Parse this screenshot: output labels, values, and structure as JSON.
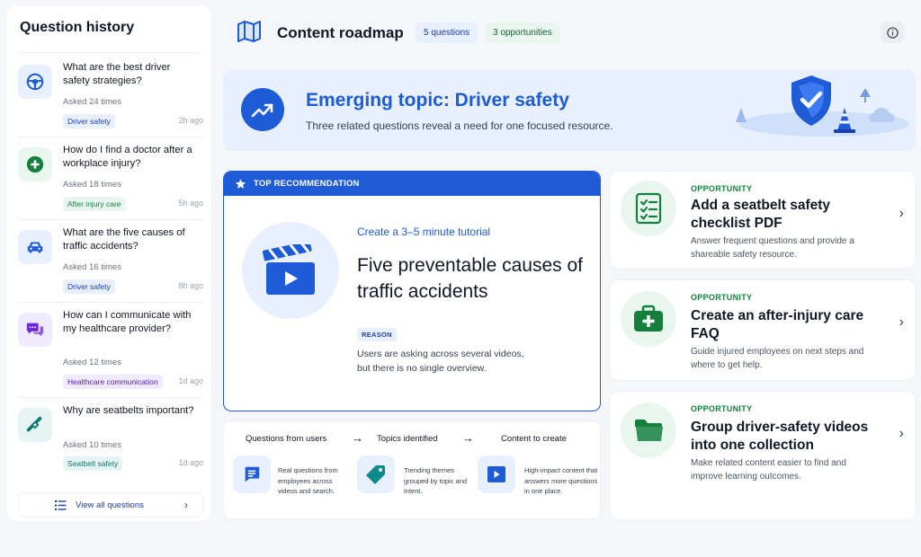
{
  "sidebar": {
    "title": "Question history",
    "items": [
      {
        "question": "What are the best driver safety strategies?",
        "asked": "Asked 24 times",
        "tag": "Driver safety",
        "time": "2h ago",
        "icon": "steering-wheel-icon"
      },
      {
        "question": "How do I find a doctor after a workplace injury?",
        "asked": "Asked 18 times",
        "tag": "After injury care",
        "time": "5h ago",
        "icon": "medical-cross-icon"
      },
      {
        "question": "What are the five causes of traffic accidents?",
        "asked": "Asked 16 times",
        "tag": "Driver safety",
        "time": "8h ago",
        "icon": "car-icon"
      },
      {
        "question": "How can I communicate with my healthcare provider?",
        "asked": "Asked 12 times",
        "tag": "Healthcare communication",
        "time": "1d ago",
        "icon": "chat-bubbles-icon"
      },
      {
        "question": "Why are seatbelts important?",
        "asked": "Asked 10 times",
        "tag": "Seatbelt safety",
        "time": "1d ago",
        "icon": "seatbelt-icon"
      }
    ],
    "view_all": "View all questions"
  },
  "header": {
    "title": "Content roadmap",
    "questions_pill": "5 questions",
    "opportunities_pill": "3 opportunities"
  },
  "banner": {
    "title": "Emerging topic: Driver safety",
    "subtitle": "Three related questions reveal a need for one focused resource."
  },
  "recommendation": {
    "header": "TOP RECOMMENDATION",
    "kicker": "Create a 3–5 minute tutorial",
    "title": "Five preventable causes of traffic accidents",
    "reason_tag": "REASON",
    "reason_line1": "Users are asking across several videos,",
    "reason_line2": "but there is no single overview."
  },
  "flow": {
    "steps": [
      {
        "label": "Questions from users",
        "desc": "Real questions from employees across videos and search."
      },
      {
        "label": "Topics identified",
        "desc": "Trending themes grouped by topic and intent."
      },
      {
        "label": "Content to create",
        "desc": "High-impact content that answers more questions in one place."
      }
    ],
    "arrow": "→"
  },
  "opportunities": [
    {
      "kicker": "OPPORTUNITY",
      "title": "Add a seatbelt safety checklist PDF",
      "desc": "Answer frequent questions and provide a shareable safety resource.",
      "icon": "checklist-icon"
    },
    {
      "kicker": "OPPORTUNITY",
      "title": "Create an after-injury care FAQ",
      "desc": "Guide injured employees on next steps and where to get help.",
      "icon": "first-aid-kit-icon"
    },
    {
      "kicker": "OPPORTUNITY",
      "title": "Group driver-safety videos into one collection",
      "desc": "Make related content easier to find and improve learning outcomes.",
      "icon": "folder-icon"
    }
  ],
  "colors": {
    "accent_blue": "#1e5bd6",
    "opportunity_green": "#15803d",
    "banner_bg": "#e8f0fd"
  }
}
